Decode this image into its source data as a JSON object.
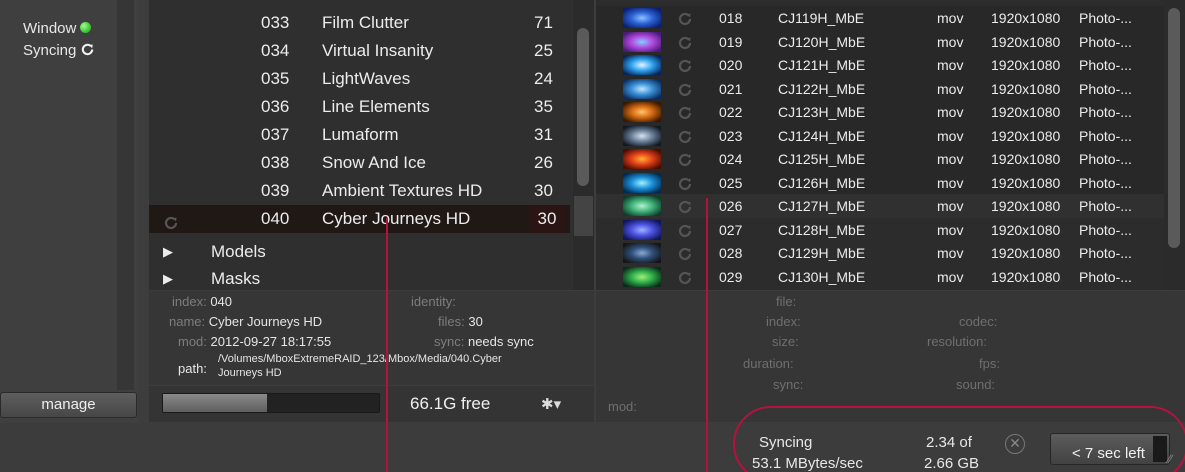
{
  "status": {
    "window_label": "Window",
    "syncing_label": "Syncing",
    "manage_button": "manage"
  },
  "collections": [
    {
      "num": "033",
      "name": "Film Clutter",
      "count": "71"
    },
    {
      "num": "034",
      "name": "Virtual Insanity",
      "count": "25"
    },
    {
      "num": "035",
      "name": "LightWaves",
      "count": "24"
    },
    {
      "num": "036",
      "name": "Line Elements",
      "count": "35"
    },
    {
      "num": "037",
      "name": "Lumaform",
      "count": "31"
    },
    {
      "num": "038",
      "name": "Snow And Ice",
      "count": "26"
    },
    {
      "num": "039",
      "name": "Ambient Textures HD",
      "count": "30"
    },
    {
      "num": "040",
      "name": "Cyber Journeys HD",
      "count": "30",
      "selected": true
    }
  ],
  "groups": [
    {
      "label": "Models"
    },
    {
      "label": "Masks"
    }
  ],
  "collection_info": {
    "index_label": "index:",
    "index_value": "040",
    "name_label": "name:",
    "name_value": "Cyber Journeys HD",
    "mod_label": "mod:",
    "mod_value": "2012-09-27 18:17:55",
    "path_label": "path:",
    "path_value_1": "/Volumes/MboxExtremeRAID_123/Mbox/Media/040.Cyber",
    "path_value_2": "Journeys HD",
    "identity_label": "identity:",
    "files_label": "files:",
    "files_value": "30",
    "sync_label": "sync:",
    "sync_value": "needs sync"
  },
  "disk": {
    "free_text": "66.1G free",
    "used_fraction": 0.48,
    "menu_icon": "gear-icon"
  },
  "media": [
    {
      "num": "018",
      "name": "CJ119H_MbE",
      "type": "mov",
      "res": "1920x1080",
      "desc": "Photo-...",
      "colors": [
        "#0a1f6e",
        "#2d63d8",
        "#8fc3ff"
      ]
    },
    {
      "num": "019",
      "name": "CJ120H_MbE",
      "type": "mov",
      "res": "1920x1080",
      "desc": "Photo-...",
      "colors": [
        "#4a1a7a",
        "#b34be0",
        "#7fd0ff"
      ]
    },
    {
      "num": "020",
      "name": "CJ121H_MbE",
      "type": "mov",
      "res": "1920x1080",
      "desc": "Photo-...",
      "colors": [
        "#06245a",
        "#2fa3f0",
        "#e5f7ff"
      ]
    },
    {
      "num": "021",
      "name": "CJ122H_MbE",
      "type": "mov",
      "res": "1920x1080",
      "desc": "Photo-...",
      "colors": [
        "#0b2d5e",
        "#3a8fd6",
        "#bfe7ff"
      ]
    },
    {
      "num": "022",
      "name": "CJ123H_MbE",
      "type": "mov",
      "res": "1920x1080",
      "desc": "Photo-...",
      "colors": [
        "#3a1800",
        "#d46a11",
        "#ffc46a"
      ]
    },
    {
      "num": "023",
      "name": "CJ124H_MbE",
      "type": "mov",
      "res": "1920x1080",
      "desc": "Photo-...",
      "colors": [
        "#101820",
        "#6a7f98",
        "#d7e3f0"
      ]
    },
    {
      "num": "024",
      "name": "CJ125H_MbE",
      "type": "mov",
      "res": "1920x1080",
      "desc": "Photo-...",
      "colors": [
        "#4a0b00",
        "#e0401a",
        "#ffb12e"
      ]
    },
    {
      "num": "025",
      "name": "CJ126H_MbE",
      "type": "mov",
      "res": "1920x1080",
      "desc": "Photo-...",
      "colors": [
        "#002a50",
        "#1c8fd8",
        "#9ff1ff"
      ]
    },
    {
      "num": "026",
      "name": "CJ127H_MbE",
      "type": "mov",
      "res": "1920x1080",
      "desc": "Photo-...",
      "colors": [
        "#0f3b2a",
        "#3fb37a",
        "#b5f0cf"
      ]
    },
    {
      "num": "027",
      "name": "CJ128H_MbE",
      "type": "mov",
      "res": "1920x1080",
      "desc": "Photo-...",
      "colors": [
        "#10145a",
        "#4b52e0",
        "#9fb3ff"
      ]
    },
    {
      "num": "028",
      "name": "CJ129H_MbE",
      "type": "mov",
      "res": "1920x1080",
      "desc": "Photo-...",
      "colors": [
        "#151515",
        "#2f4f7a",
        "#89a9d6"
      ]
    },
    {
      "num": "029",
      "name": "CJ130H_MbE",
      "type": "mov",
      "res": "1920x1080",
      "desc": "Photo-...",
      "colors": [
        "#0a2a1a",
        "#2fae4a",
        "#9ff07a"
      ]
    }
  ],
  "media_info": {
    "file_label": "file:",
    "index_label": "index:",
    "size_label": "size:",
    "duration_label": "duration:",
    "sync_label": "sync:",
    "codec_label": "codec:",
    "resolution_label": "resolution:",
    "fps_label": "fps:",
    "sound_label": "sound:",
    "mod_label": "mod:"
  },
  "sync_status": {
    "state": "Syncing",
    "rate": "53.1 MBytes/sec",
    "done": "2.34 of",
    "total": "2.66 GB",
    "time_left": "< 7 sec left",
    "progress_fraction": 0.88
  },
  "accent_colors": {
    "highlight_ring": "#b5123f",
    "led_green": "#2fbf2a"
  }
}
